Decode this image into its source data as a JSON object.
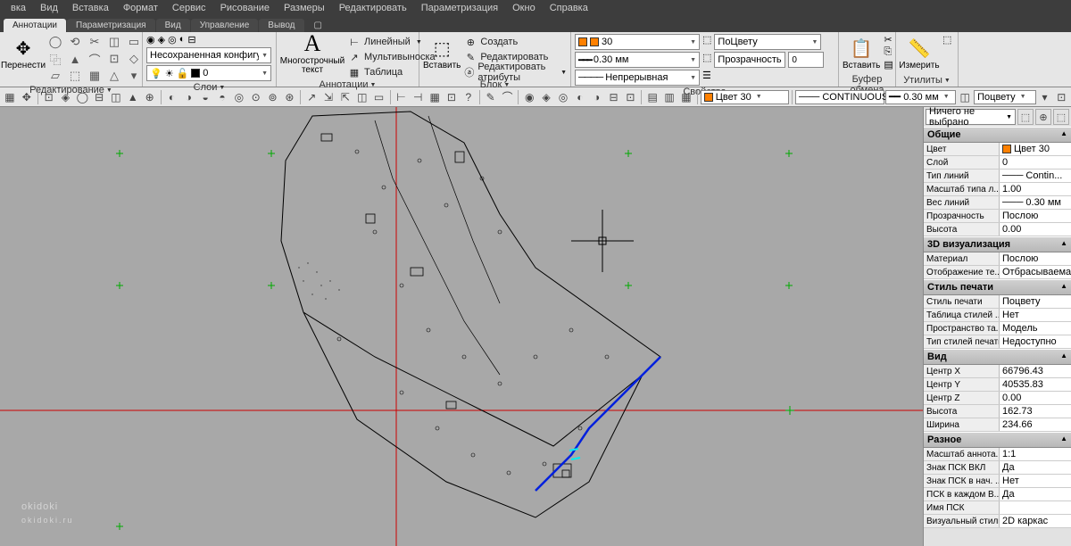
{
  "menubar": [
    "вка",
    "Вид",
    "Вставка",
    "Формат",
    "Сервис",
    "Рисование",
    "Размеры",
    "Редактировать",
    "Параметризация",
    "Окно",
    "Справка"
  ],
  "tabs": [
    "Аннотации",
    "Параметризация",
    "Вид",
    "Управление",
    "Вывод"
  ],
  "active_tab": "Аннотации",
  "ribbon": {
    "g1": {
      "label": "Редактирование",
      "btn": "Перенести"
    },
    "g2": {
      "label": "Слои",
      "combo": "Несохраненная конфигурация сл",
      "layer0": "0"
    },
    "g3": {
      "label": "Аннотации",
      "btn": "Многострочный текст",
      "items": [
        "Линейный",
        "Мультивыноска",
        "Таблица"
      ]
    },
    "g4": {
      "label": "Блок",
      "btn": "Вставить",
      "items": [
        "Создать",
        "Редактировать",
        "Редактировать атрибуты"
      ]
    },
    "g5": {
      "label": "Свойства",
      "color": {
        "val": "30",
        "hex": "#ff8000"
      },
      "bycolor": "ПоЦвету",
      "lw": "0.30 мм",
      "trans_label": "Прозрачность",
      "trans_val": "0",
      "lt": "Непрерывная"
    },
    "g6": {
      "label": "Буфер обмена",
      "btn": "Вставить"
    },
    "g7": {
      "label": "Утилиты",
      "btn": "Измерить"
    }
  },
  "toolbar2": {
    "layer_combo": "Цвет 30",
    "lt_combo": "CONTINUOUS",
    "lw_combo": "0.30 мм",
    "bycolor": "Поцвету"
  },
  "props": {
    "selection": "Ничего не выбрано",
    "groups": [
      {
        "title": "Общие",
        "rows": [
          {
            "k": "Цвет",
            "v": "Цвет 30",
            "sw": "#ff8000"
          },
          {
            "k": "Слой",
            "v": "0"
          },
          {
            "k": "Тип линий",
            "v": "Contin..."
          },
          {
            "k": "Масштаб типа л...",
            "v": "1.00"
          },
          {
            "k": "Вес линий",
            "v": "0.30 мм"
          },
          {
            "k": "Прозрачность",
            "v": "Послою"
          },
          {
            "k": "Высота",
            "v": "0.00"
          }
        ]
      },
      {
        "title": "3D визуализация",
        "rows": [
          {
            "k": "Материал",
            "v": "Послою"
          },
          {
            "k": "Отображение те...",
            "v": "Отбрасываема..."
          }
        ]
      },
      {
        "title": "Стиль печати",
        "rows": [
          {
            "k": "Стиль печати",
            "v": "Поцвету"
          },
          {
            "k": "Таблица стилей ...",
            "v": "Нет"
          },
          {
            "k": "Пространство та...",
            "v": "Модель"
          },
          {
            "k": "Тип стилей печати",
            "v": "Недоступно"
          }
        ]
      },
      {
        "title": "Вид",
        "rows": [
          {
            "k": "Центр X",
            "v": "66796.43"
          },
          {
            "k": "Центр Y",
            "v": "40535.83"
          },
          {
            "k": "Центр Z",
            "v": "0.00"
          },
          {
            "k": "Высота",
            "v": "162.73"
          },
          {
            "k": "Ширина",
            "v": "234.66"
          }
        ]
      },
      {
        "title": "Разное",
        "rows": [
          {
            "k": "Масштаб аннота...",
            "v": "1:1"
          },
          {
            "k": "Знак ПСК ВКЛ",
            "v": "Да"
          },
          {
            "k": "Знак ПСК в нач. ...",
            "v": "Нет"
          },
          {
            "k": "ПСК в каждом В...",
            "v": "Да"
          },
          {
            "k": "Имя ПСК",
            "v": ""
          },
          {
            "k": "Визуальный стиль",
            "v": "2D каркас"
          }
        ]
      }
    ]
  },
  "watermark": {
    "main": "okidoki",
    "sub": "okidoki.ru"
  }
}
